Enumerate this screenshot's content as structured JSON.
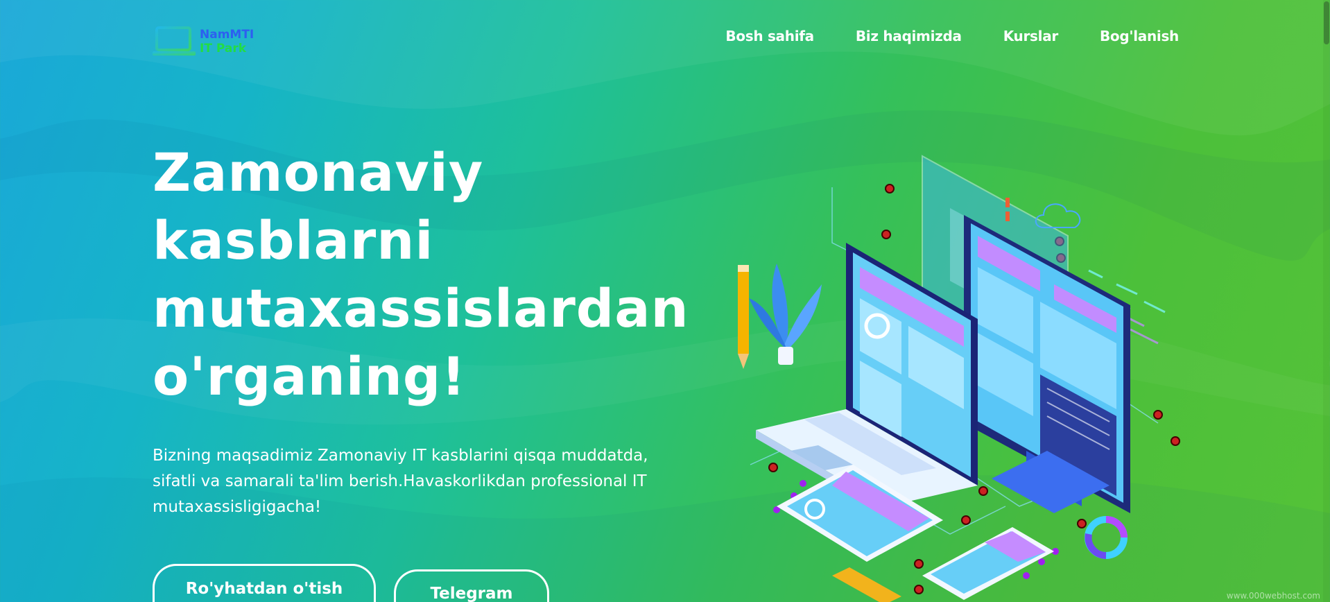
{
  "logo": {
    "line1": "NamMTI",
    "line2": "IT Park",
    "icon": "laptop-icon"
  },
  "nav": {
    "items": [
      {
        "label": "Bosh sahifa"
      },
      {
        "label": "Biz haqimizda"
      },
      {
        "label": "Kurslar"
      },
      {
        "label": "Bog'lanish"
      }
    ]
  },
  "hero": {
    "title_lines": [
      "Zamonaviy",
      "kasblarni",
      "mutaxassislardan",
      "o'rganing!"
    ],
    "description": "Bizning maqsadimiz Zamonaviy IT kasblarini qisqa muddatda, sifatli va samarali ta'lim berish.Havaskorlikdan professional IT mutaxassisligigacha!",
    "buttons": {
      "register": "Ro'yhatdan o'tish",
      "telegram": "Telegram"
    }
  },
  "footer": {
    "watermark": "www.000webhost.com"
  },
  "colors": {
    "gradient_start": "#1aa8d8",
    "gradient_end": "#55c238",
    "logo_blue": "#2d5ff0",
    "logo_green": "#22dd44"
  }
}
